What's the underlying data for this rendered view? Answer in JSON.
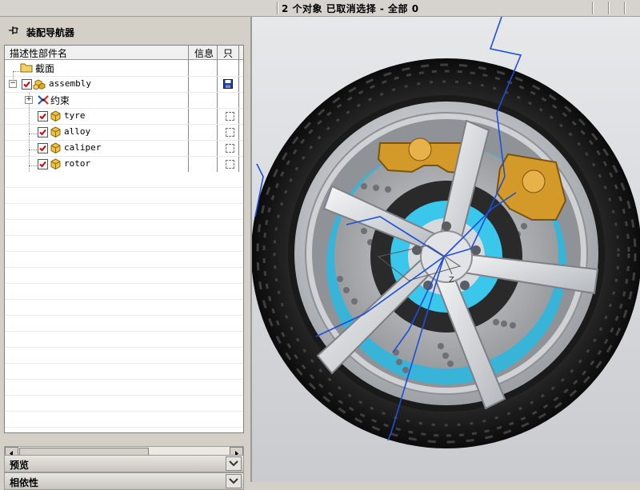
{
  "status_bar": {
    "message": "2 个对象 已取消选择  - 全部 0"
  },
  "navigator": {
    "title": "装配导航器",
    "columns": {
      "name": "描述性部件名",
      "info": "信息",
      "readonly": "只"
    },
    "rows": [
      {
        "label": "截面",
        "icon": "folder-icon"
      },
      {
        "label": "assembly",
        "icon": "assembly-icon",
        "checked": true,
        "saved": true
      },
      {
        "label": "约束",
        "icon": "constraints-icon"
      },
      {
        "label": "tyre",
        "icon": "part-icon",
        "checked": true
      },
      {
        "label": "alloy",
        "icon": "part-icon",
        "checked": true
      },
      {
        "label": "caliper",
        "icon": "part-icon",
        "checked": true
      },
      {
        "label": "rotor",
        "icon": "part-icon",
        "checked": true
      }
    ],
    "sections": [
      {
        "title": "预览"
      },
      {
        "title": "相依性"
      }
    ]
  },
  "viewport": {
    "model": "wheel assembly 3D view",
    "colors": {
      "tyre": "#1f1f1f",
      "rim": "#cfd2d6",
      "caliper": "#d39a2a",
      "rotor": "#a9acb0",
      "hub_inner": "#35c6ea",
      "wire": "#1d4fd8"
    },
    "axis_label": "Z"
  }
}
